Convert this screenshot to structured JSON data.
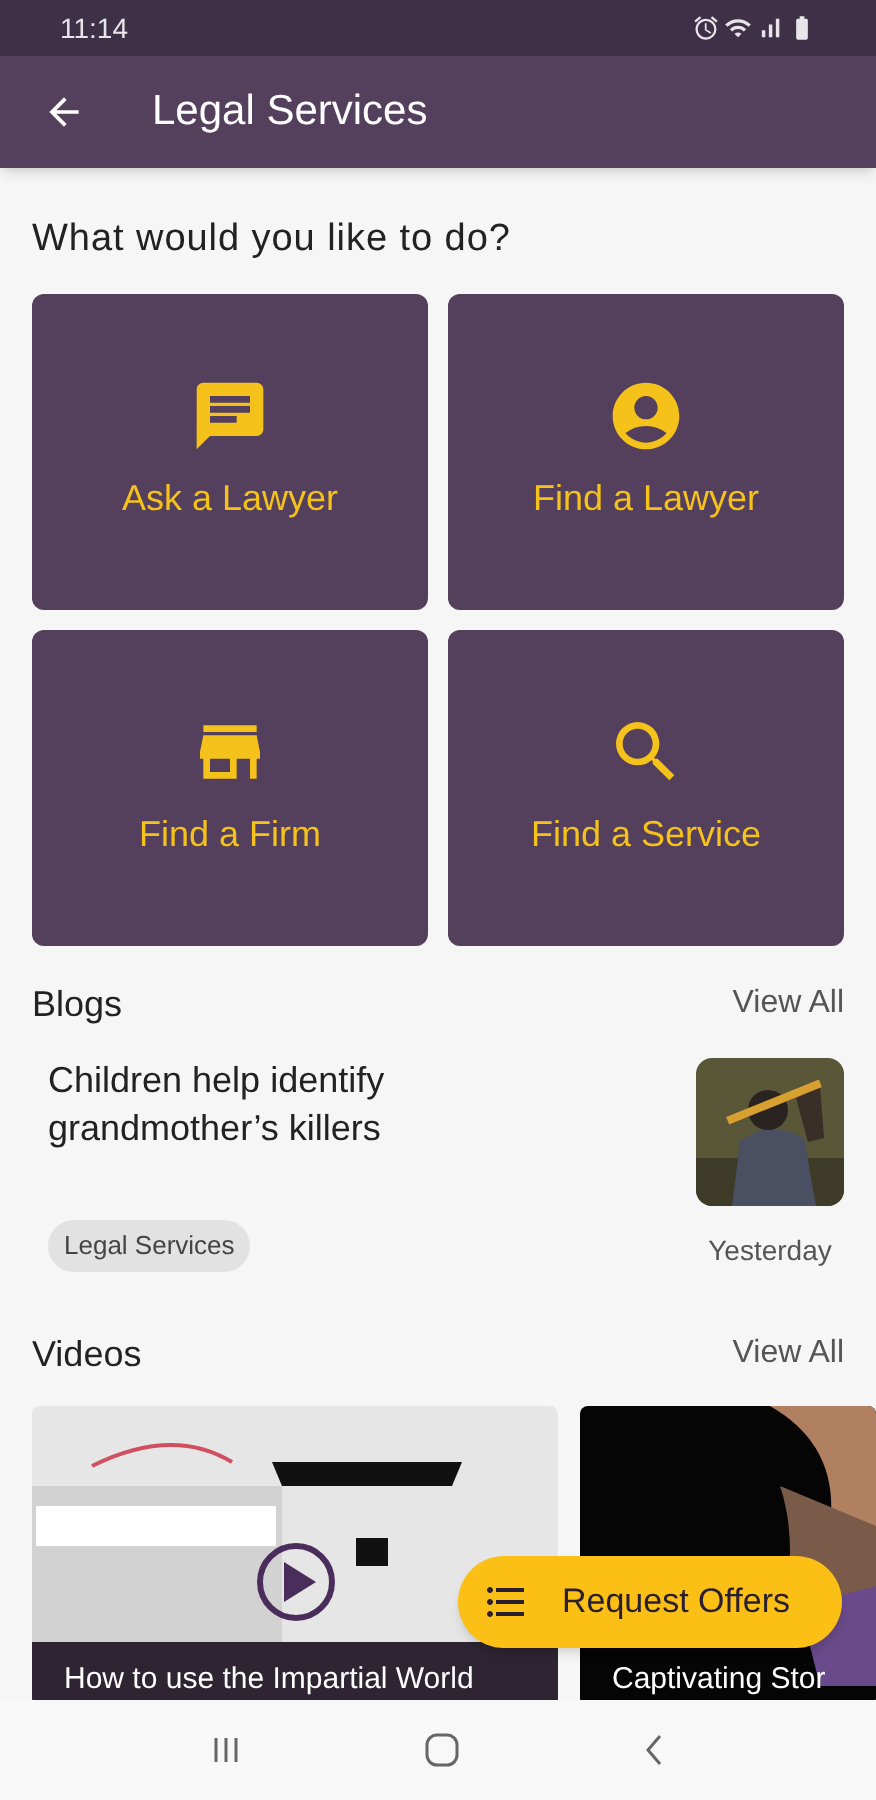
{
  "status_bar": {
    "time": "11:14"
  },
  "app_bar": {
    "title": "Legal Services"
  },
  "prompt": "What would you like to do?",
  "actions": [
    {
      "label": "Ask a Lawyer",
      "kind": "chat"
    },
    {
      "label": "Find a Lawyer",
      "kind": "person"
    },
    {
      "label": "Find a Firm",
      "kind": "store"
    },
    {
      "label": "Find a Service",
      "kind": "search"
    }
  ],
  "blogs": {
    "title": "Blogs",
    "view_all": "View All",
    "items": [
      {
        "headline": "Children help identify grandmother’s killers",
        "tag": "Legal Services",
        "date": "Yesterday"
      }
    ]
  },
  "videos": {
    "title": "Videos",
    "view_all": "View All",
    "items": [
      {
        "title": "How to use the Impartial World"
      },
      {
        "title": "Captivating Stor"
      }
    ]
  },
  "fab": {
    "label": "Request Offers"
  }
}
